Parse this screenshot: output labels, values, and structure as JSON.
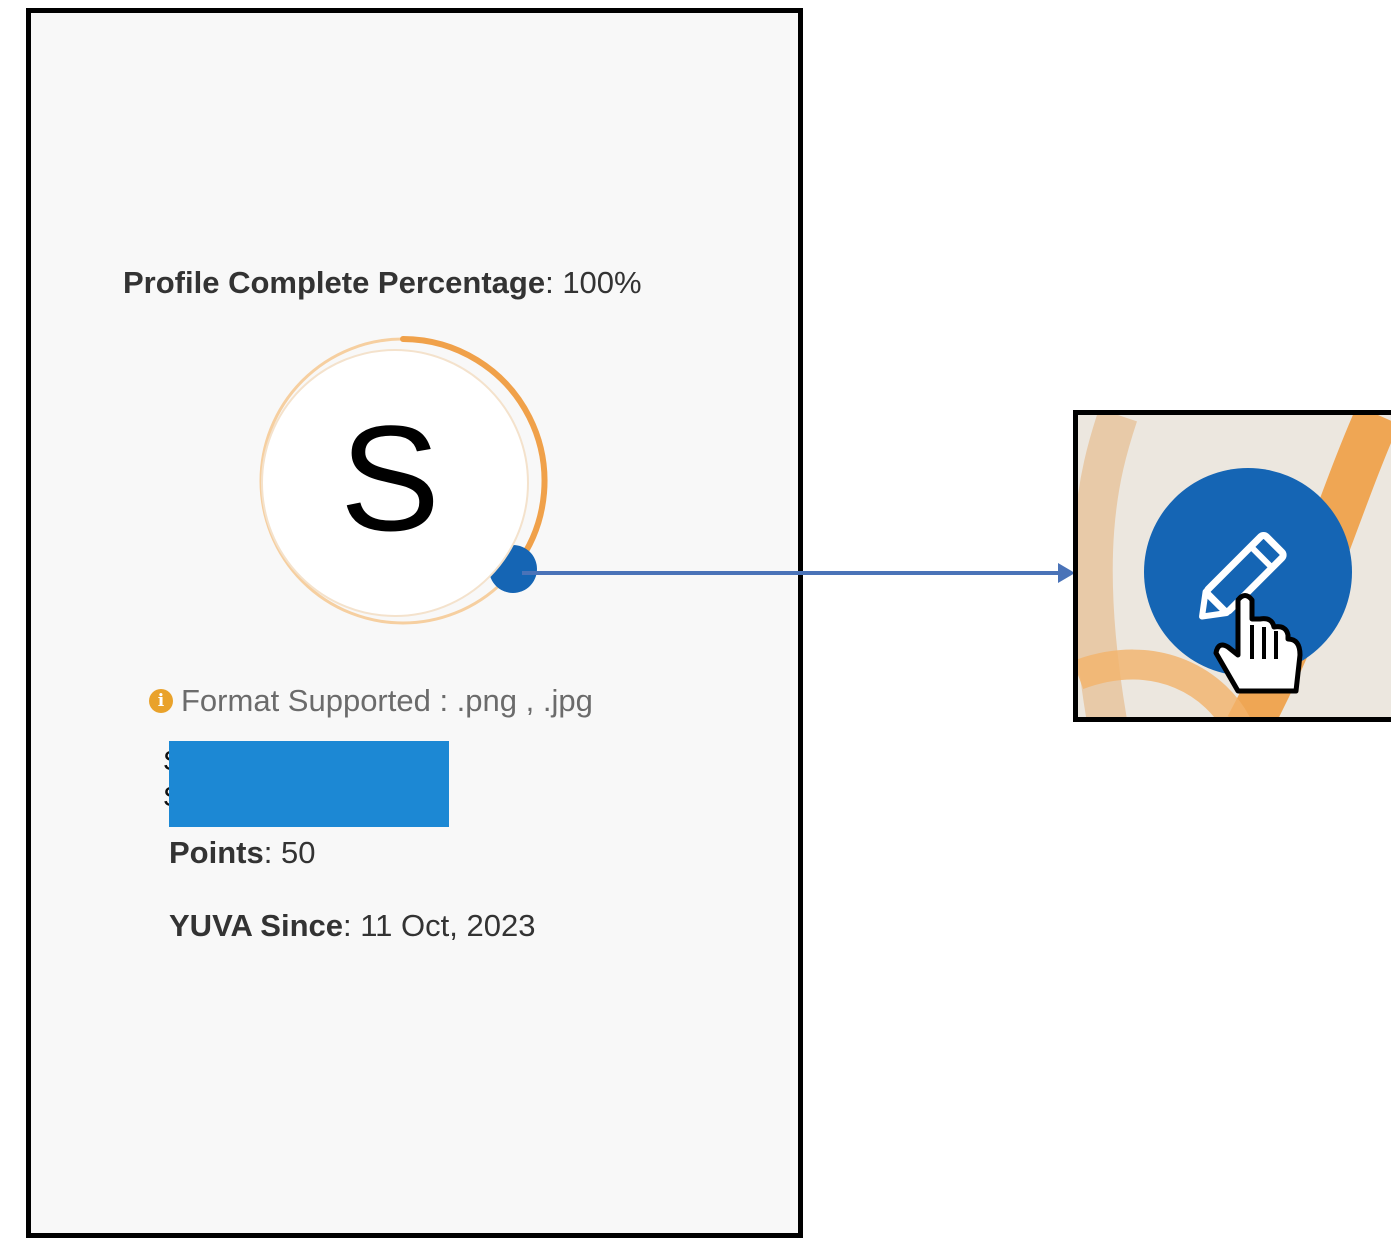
{
  "profile": {
    "percentage_label": "Profile Complete Percentage",
    "percentage_value": "100%",
    "avatar_letter": "S",
    "completion_fraction": 1.0
  },
  "upload": {
    "info_icon": "info-icon",
    "format_text": "Format Supported : .png , .jpg"
  },
  "user": {
    "name_visible_chars": [
      "S",
      "S"
    ],
    "points_label": "Points",
    "points_value": "50",
    "since_label": "YUVA Since",
    "since_value": "11 Oct, 2023"
  },
  "edit_button": {
    "icon": "pencil-icon",
    "cursor": "hand-pointer-icon"
  },
  "colors": {
    "accent_blue": "#1565b4",
    "progress_orange": "#f0a14a",
    "redaction_blue": "#1c88d4",
    "arrow_blue": "#4a73b8"
  }
}
